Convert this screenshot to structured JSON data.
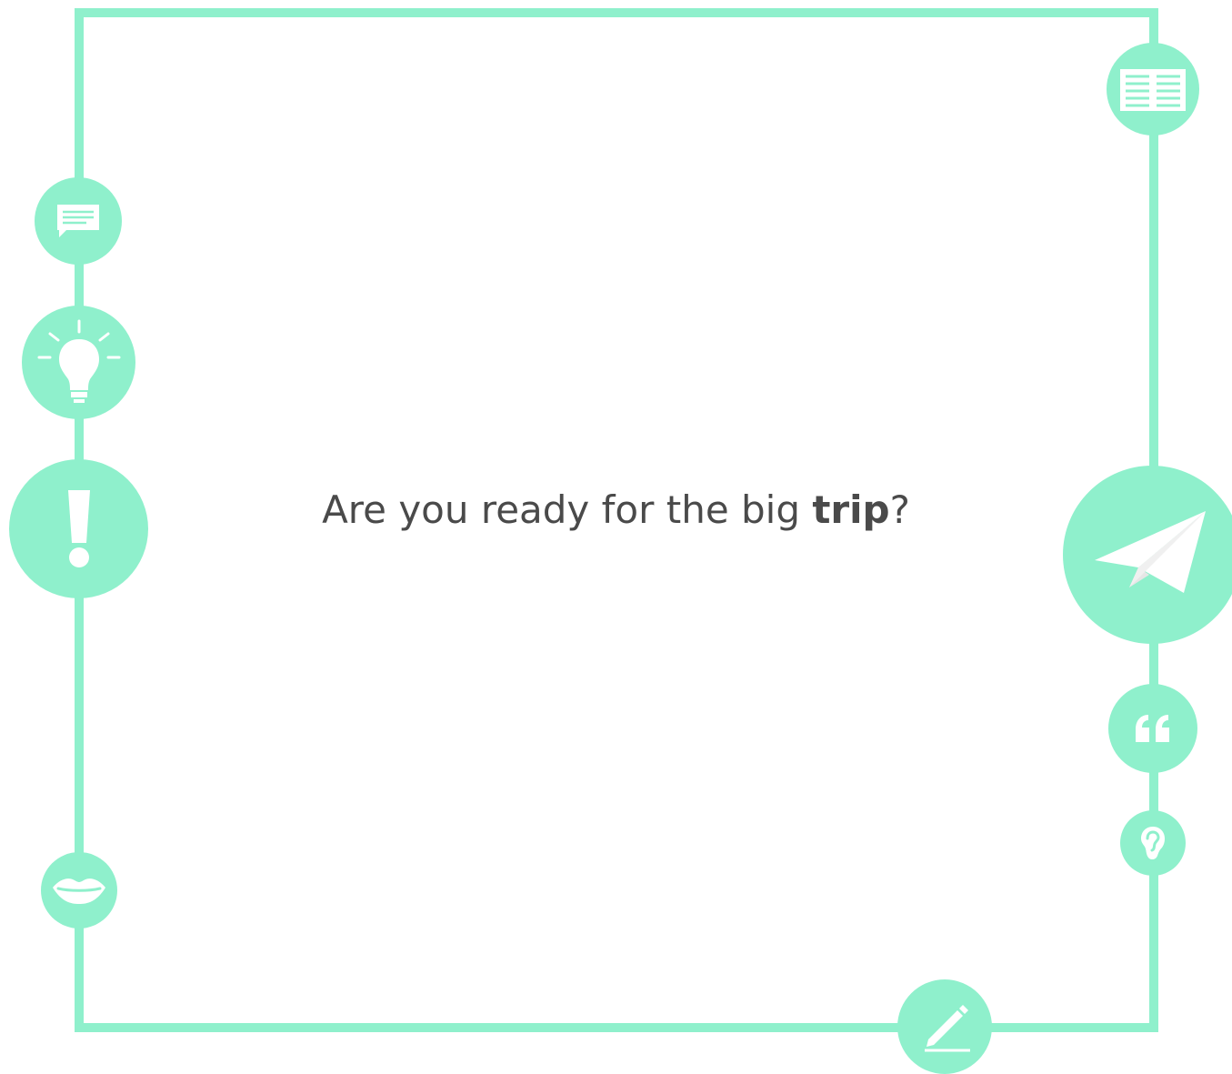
{
  "slide": {
    "text_before": "Are you ready for the big ",
    "text_bold": "trip",
    "text_after": "?"
  },
  "theme": {
    "accent": "#8ff0cc",
    "text_color": "#4a4a4a",
    "icon_fill": "#ffffff"
  },
  "icons": [
    "book-icon",
    "speech-bubble-icon",
    "lightbulb-icon",
    "exclamation-icon",
    "paper-plane-icon",
    "quote-icon",
    "ear-icon",
    "lips-icon",
    "pencil-icon"
  ]
}
